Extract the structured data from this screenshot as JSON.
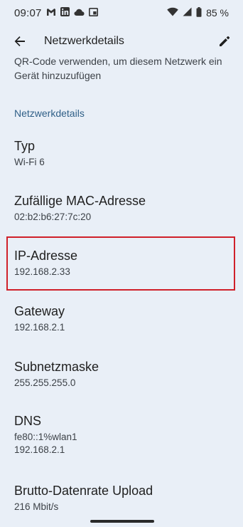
{
  "status": {
    "time": "09:07",
    "battery": "85 %"
  },
  "app_bar": {
    "title": "Netzwerkdetails"
  },
  "qr_text": "QR-Code verwenden, um diesem Netzwerk ein Gerät hinzuzufügen",
  "section_header": "Netzwerkdetails",
  "items": [
    {
      "label": "Typ",
      "value": "Wi-Fi 6"
    },
    {
      "label": "Zufällige MAC-Adresse",
      "value": "02:b2:b6:27:7c:20"
    },
    {
      "label": "IP-Adresse",
      "value": "192.168.2.33"
    },
    {
      "label": "Gateway",
      "value": "192.168.2.1"
    },
    {
      "label": "Subnetzmaske",
      "value": "255.255.255.0"
    },
    {
      "label": "DNS",
      "value_line1": "fe80::1%wlan1",
      "value_line2": "192.168.2.1"
    },
    {
      "label": "Brutto-Datenrate Upload",
      "value": "216 Mbit/s"
    }
  ],
  "icons": {
    "status_left": [
      "gmail-icon",
      "linkedin-icon",
      "cloud-icon",
      "cast-icon"
    ],
    "status_right": [
      "wifi-icon",
      "signal-icon",
      "battery-icon"
    ],
    "app_bar": [
      "back-arrow-icon",
      "edit-pencil-icon"
    ]
  },
  "colors": {
    "background": "#e9eff7",
    "section_header": "#2f5f87",
    "highlight_border": "#d0202a"
  }
}
